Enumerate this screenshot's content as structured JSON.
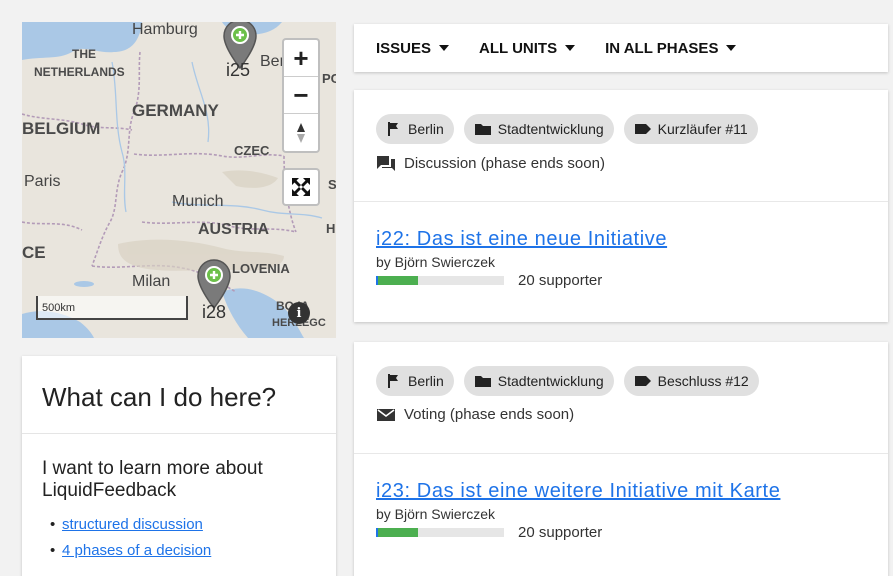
{
  "map": {
    "labels": {
      "hamburg": "Hamburg",
      "the": "THE",
      "netherlands": "NETHERLANDS",
      "berlin": "Berli",
      "pol": "PC",
      "germany": "GERMANY",
      "belgium": "BELGIUM",
      "czech": "CZEC",
      "paris": "Paris",
      "munich": "Munich",
      "austria": "AUSTRIA",
      "h": "H",
      "s": "S",
      "ce": "CE",
      "slovenia": "LOVENIA",
      "milan": "Milan",
      "bosnia": "BO  IA",
      "herzeg": "HERZEGC"
    },
    "markers": [
      {
        "label": "i25"
      },
      {
        "label": "i28"
      }
    ],
    "zoom_in": "+",
    "zoom_out": "−",
    "scale_label": "500km",
    "attribution": "i"
  },
  "info": {
    "title": "What can I do here?",
    "subtitle": "I want to learn more about LiquidFeedback",
    "links": [
      "structured discussion",
      "4 phases of a decision"
    ]
  },
  "filters": [
    {
      "label": "ISSUES"
    },
    {
      "label": "ALL UNITS"
    },
    {
      "label": "IN ALL PHASES"
    }
  ],
  "issues": [
    {
      "chips": [
        {
          "icon": "flag-icon",
          "label": "Berlin"
        },
        {
          "icon": "folder-icon",
          "label": "Stadtentwicklung"
        },
        {
          "icon": "tag-icon",
          "label": "Kurzläufer #11"
        }
      ],
      "status_icon": "discussion-icon",
      "status": "Discussion (phase ends soon)",
      "initiative": {
        "title": "i22: Das ist eine neue Initiative",
        "author": "by Björn Swierczek",
        "supporters": "20 supporter",
        "support_fraction": 0.33
      }
    },
    {
      "chips": [
        {
          "icon": "flag-icon",
          "label": "Berlin"
        },
        {
          "icon": "folder-icon",
          "label": "Stadtentwicklung"
        },
        {
          "icon": "tag-icon",
          "label": "Beschluss #12"
        }
      ],
      "status_icon": "envelope-icon",
      "status": "Voting (phase ends soon)",
      "initiative": {
        "title": "i23: Das ist eine weitere Initiative mit Karte",
        "author": "by Björn Swierczek",
        "supporters": "20 supporter",
        "support_fraction": 0.33
      }
    }
  ],
  "colors": {
    "link": "#1e73e8",
    "support_bar": "#4caf50",
    "marker": "#7a7a7a",
    "marker_plus": "#6cc04a",
    "water": "#aac8e6",
    "land": "#e8e4dc"
  }
}
